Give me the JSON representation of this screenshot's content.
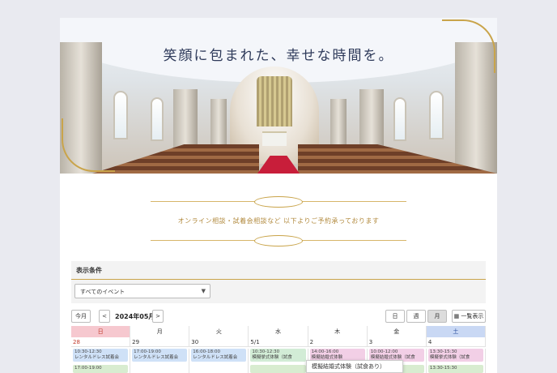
{
  "hero": {
    "tagline": "笑顔に包まれた、幸せな時間を。"
  },
  "notice": "オンライン相談・試着会相談など 以下よりご予約承っております",
  "filter": {
    "label": "表示条件",
    "select_value": "すべてのイベント"
  },
  "toolbar": {
    "today": "今月",
    "prev": "<",
    "next": ">",
    "month": "2024年05月",
    "view_day": "日",
    "view_week": "週",
    "view_month": "月",
    "list": "一覧表示"
  },
  "calendar": {
    "weekdays": [
      "日",
      "月",
      "火",
      "水",
      "木",
      "金",
      "土"
    ],
    "dates": [
      "28",
      "29",
      "30",
      "5/1",
      "2",
      "3",
      "4"
    ],
    "events": [
      {
        "time": "10:30-12:30",
        "title": "レンタルドレス試着会",
        "color": "blue"
      },
      {
        "time": "17:00-19:00",
        "title": "レンタルドレス試着会",
        "color": "blue"
      },
      {
        "time": "16:00-18:00",
        "title": "レンタルドレス試着会",
        "color": "blue"
      },
      {
        "time": "10:30-12:30",
        "title": "模擬挙式体験（試食",
        "color": "green"
      },
      {
        "time": "14:00-16:00",
        "title": "模擬結婚式体験",
        "color": "pink"
      },
      {
        "time": "10:00-12:00",
        "title": "模擬結婚式体験（試食",
        "color": "pink"
      },
      {
        "time": "13:30-15:30",
        "title": "模擬挙式体験（試食",
        "color": "pink"
      }
    ],
    "second_row_times": [
      "17:00-19:00",
      "",
      "",
      "",
      "",
      "",
      "13:30-15:30"
    ]
  },
  "tooltip": "模擬結婚式体験（試食あり）"
}
